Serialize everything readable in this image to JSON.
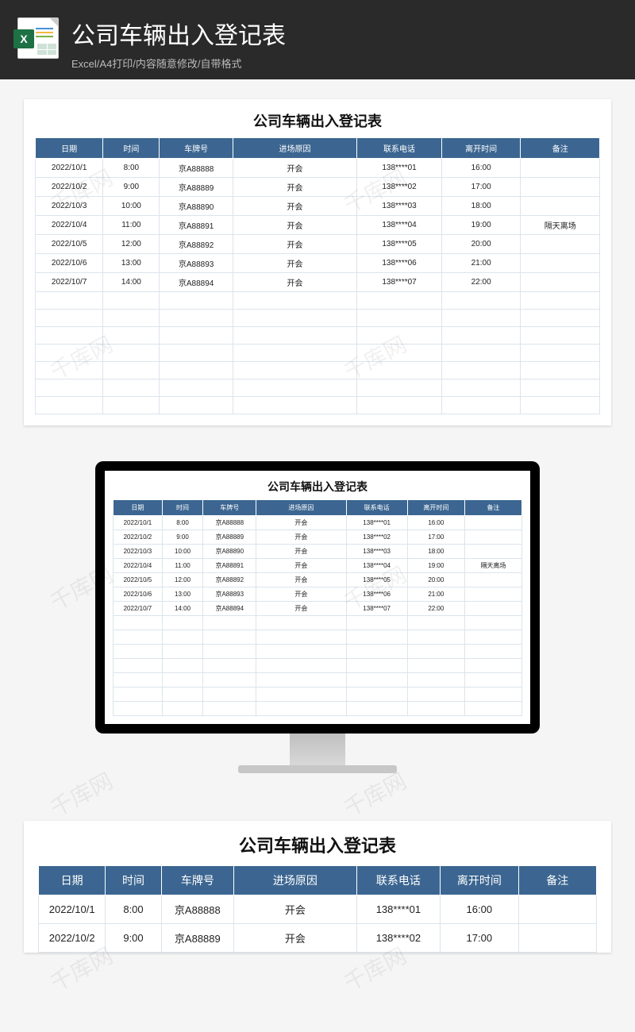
{
  "header": {
    "title": "公司车辆出入登记表",
    "subtitle": "Excel/A4打印/内容随意修改/自带格式",
    "icon_letter": "X"
  },
  "watermark_text": "千库网",
  "sheet": {
    "title": "公司车辆出入登记表",
    "columns": [
      "日期",
      "时间",
      "车牌号",
      "进场原因",
      "联系电话",
      "离开时间",
      "备注"
    ],
    "rows": [
      {
        "date": "2022/10/1",
        "time": "8:00",
        "plate": "京A88888",
        "reason": "开会",
        "phone": "138****01",
        "leave": "16:00",
        "note": ""
      },
      {
        "date": "2022/10/2",
        "time": "9:00",
        "plate": "京A88889",
        "reason": "开会",
        "phone": "138****02",
        "leave": "17:00",
        "note": ""
      },
      {
        "date": "2022/10/3",
        "time": "10:00",
        "plate": "京A88890",
        "reason": "开会",
        "phone": "138****03",
        "leave": "18:00",
        "note": ""
      },
      {
        "date": "2022/10/4",
        "time": "11:00",
        "plate": "京A88891",
        "reason": "开会",
        "phone": "138****04",
        "leave": "19:00",
        "note": "隔天离场"
      },
      {
        "date": "2022/10/5",
        "time": "12:00",
        "plate": "京A88892",
        "reason": "开会",
        "phone": "138****05",
        "leave": "20:00",
        "note": ""
      },
      {
        "date": "2022/10/6",
        "time": "13:00",
        "plate": "京A88893",
        "reason": "开会",
        "phone": "138****06",
        "leave": "21:00",
        "note": ""
      },
      {
        "date": "2022/10/7",
        "time": "14:00",
        "plate": "京A88894",
        "reason": "开会",
        "phone": "138****07",
        "leave": "22:00",
        "note": ""
      }
    ],
    "empty_rows": 7
  },
  "bottom_visible_rows": 2
}
